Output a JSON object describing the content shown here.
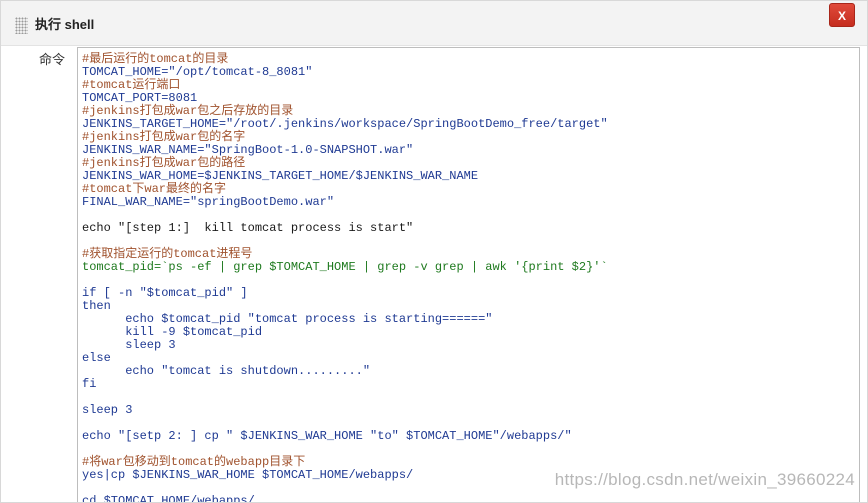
{
  "panel": {
    "title": "执行 shell",
    "close_label": "X"
  },
  "field": {
    "label": "命令"
  },
  "editor": {
    "lines": [
      {
        "text": "#最后运行的tomcat的目录",
        "kind": "comment"
      },
      {
        "text": "TOMCAT_HOME=\"/opt/tomcat-8_8081\"",
        "kind": "assign"
      },
      {
        "text": "#tomcat运行端口",
        "kind": "comment"
      },
      {
        "text": "TOMCAT_PORT=8081",
        "kind": "assign"
      },
      {
        "text": "#jenkins打包成war包之后存放的目录",
        "kind": "comment"
      },
      {
        "text": "JENKINS_TARGET_HOME=\"/root/.jenkins/workspace/SpringBootDemo_free/target\"",
        "kind": "assign"
      },
      {
        "text": "#jenkins打包成war包的名字",
        "kind": "comment"
      },
      {
        "text": "JENKINS_WAR_NAME=\"SpringBoot-1.0-SNAPSHOT.war\"",
        "kind": "assign"
      },
      {
        "text": "#jenkins打包成war包的路径",
        "kind": "comment"
      },
      {
        "text": "JENKINS_WAR_HOME=$JENKINS_TARGET_HOME/$JENKINS_WAR_NAME",
        "kind": "assign"
      },
      {
        "text": "#tomcat下war最终的名字",
        "kind": "comment"
      },
      {
        "text": "FINAL_WAR_NAME=\"springBootDemo.war\"",
        "kind": "assign"
      },
      {
        "text": "",
        "kind": "plain"
      },
      {
        "text": "echo \"[step 1:]  kill tomcat process is start\"",
        "kind": "plain"
      },
      {
        "text": "",
        "kind": "plain"
      },
      {
        "text": "#获取指定运行的tomcat进程号",
        "kind": "comment"
      },
      {
        "text": "tomcat_pid=`ps -ef | grep $TOMCAT_HOME | grep -v grep | awk '{print $2}'`",
        "kind": "green"
      },
      {
        "text": "",
        "kind": "plain"
      },
      {
        "text": "if [ -n \"$tomcat_pid\" ]",
        "kind": "keyword"
      },
      {
        "text": "then",
        "kind": "keyword"
      },
      {
        "text": "      echo $tomcat_pid \"tomcat process is starting======\"",
        "kind": "keyword"
      },
      {
        "text": "      kill -9 $tomcat_pid",
        "kind": "keyword"
      },
      {
        "text": "      sleep 3",
        "kind": "keyword"
      },
      {
        "text": "else",
        "kind": "keyword"
      },
      {
        "text": "      echo \"tomcat is shutdown.........\"",
        "kind": "keyword"
      },
      {
        "text": "fi",
        "kind": "keyword"
      },
      {
        "text": "",
        "kind": "plain"
      },
      {
        "text": "sleep 3",
        "kind": "keyword"
      },
      {
        "text": "",
        "kind": "plain"
      },
      {
        "text": "echo \"[setp 2: ] cp \" $JENKINS_WAR_HOME \"to\" $TOMCAT_HOME\"/webapps/\"",
        "kind": "keyword"
      },
      {
        "text": "",
        "kind": "plain"
      },
      {
        "text": "#将war包移动到tomcat的webapp目录下",
        "kind": "comment"
      },
      {
        "text": "yes|cp $JENKINS_WAR_HOME $TOMCAT_HOME/webapps/",
        "kind": "keyword"
      },
      {
        "text": "",
        "kind": "plain"
      },
      {
        "text": "cd $TOMCAT_HOME/webapps/",
        "kind": "keyword"
      }
    ]
  },
  "watermark": {
    "text": "https://blog.csdn.net/weixin_39660224"
  },
  "colors": {
    "comment": "#a0522d",
    "assign": "#1f3a93",
    "green": "#1f7a1f",
    "close_button": "#d23a2b"
  }
}
